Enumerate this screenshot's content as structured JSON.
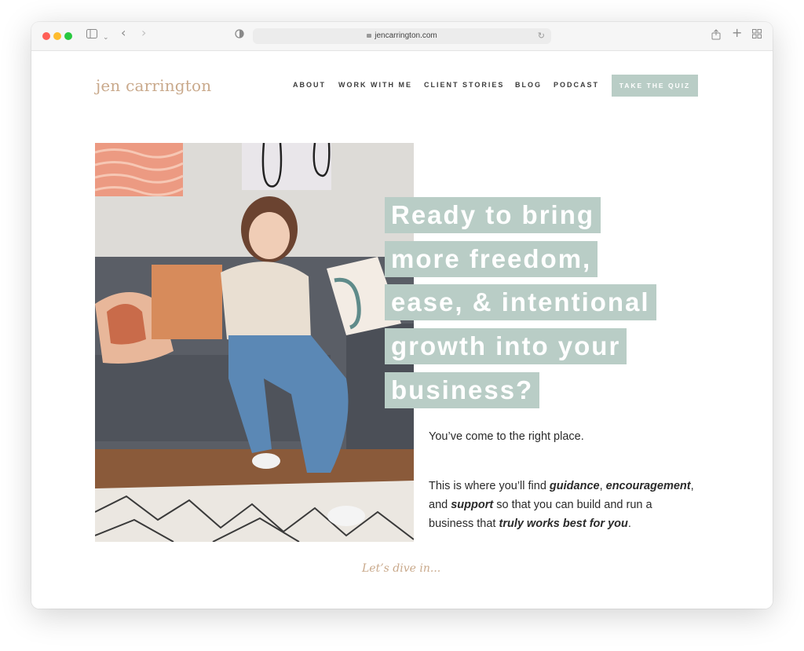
{
  "browser": {
    "url": "jencarrington.com"
  },
  "site": {
    "logo": "jen carrington",
    "nav": [
      "ABOUT",
      "WORK WITH ME",
      "CLIENT STORIES",
      "BLOG",
      "PODCAST"
    ],
    "cta_button": "TAKE THE QUIZ"
  },
  "hero": {
    "headline_lines": [
      "Ready to bring",
      "more freedom,",
      "ease, & intentional",
      "growth into your",
      "business?"
    ],
    "intro": "You’ve come to the right place.",
    "p_1": "This is where you’ll find ",
    "b_1": "guidance",
    "p_2": ", ",
    "b_2": "encouragement",
    "p_3": ", and ",
    "b_3": "support",
    "p_4": " so that you can build and run a business that ",
    "b_4": "truly works best for you",
    "p_5": ".",
    "dive_in": "Let’s dive in..."
  },
  "colors": {
    "accent": "#b9cdc6",
    "logo": "#c9a98b"
  }
}
